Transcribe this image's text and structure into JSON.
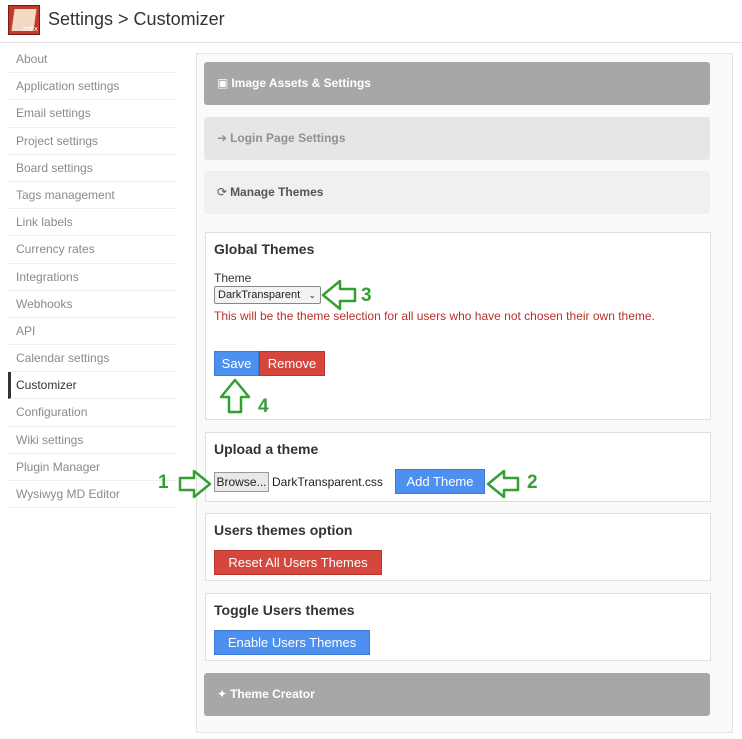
{
  "header": {
    "title": "Settings > Customizer"
  },
  "sidebar": {
    "items": [
      {
        "label": "About"
      },
      {
        "label": "Application settings"
      },
      {
        "label": "Email settings"
      },
      {
        "label": "Project settings"
      },
      {
        "label": "Board settings"
      },
      {
        "label": "Tags management"
      },
      {
        "label": "Link labels"
      },
      {
        "label": "Currency rates"
      },
      {
        "label": "Integrations"
      },
      {
        "label": "Webhooks"
      },
      {
        "label": "API"
      },
      {
        "label": "Calendar settings"
      },
      {
        "label": "Customizer"
      },
      {
        "label": "Configuration"
      },
      {
        "label": "Wiki settings"
      },
      {
        "label": "Plugin Manager"
      },
      {
        "label": "Wysiwyg MD Editor"
      }
    ],
    "active": "Customizer"
  },
  "sections": {
    "image_assets": "Image Assets & Settings",
    "login_page": "Login Page Settings",
    "manage_themes": "Manage Themes",
    "theme_creator": "Theme Creator"
  },
  "global_themes": {
    "heading": "Global Themes",
    "theme_label": "Theme",
    "selected": "DarkTransparent",
    "warning": "This will be the theme selection for all users who have not chosen their own theme.",
    "save": "Save",
    "remove": "Remove"
  },
  "upload": {
    "heading": "Upload a theme",
    "browse": "Browse...",
    "file_name": "DarkTransparent.css",
    "add": "Add Theme"
  },
  "users_option": {
    "heading": "Users themes option",
    "reset": "Reset All Users Themes"
  },
  "toggle_users": {
    "heading": "Toggle Users themes",
    "enable": "Enable Users Themes"
  },
  "annotations": {
    "n1": "1",
    "n2": "2",
    "n3": "3",
    "n4": "4",
    "color": "#33a033"
  }
}
